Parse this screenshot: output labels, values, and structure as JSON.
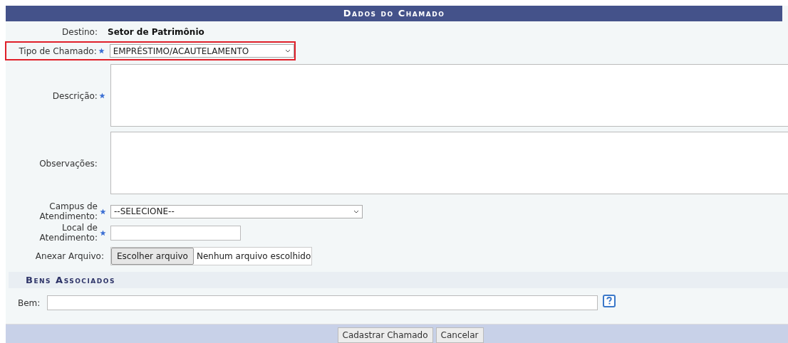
{
  "panel": {
    "title": "Dados do Chamado"
  },
  "destino": {
    "label": "Destino:",
    "value": "Setor de Patrimônio"
  },
  "fields": [
    {
      "kind": "select",
      "label": "Tipo de Chamado:",
      "required": true,
      "highlighted": true,
      "value": "EMPRÉSTIMO/ACAUTELAMENTO"
    },
    {
      "kind": "textarea",
      "label": "Descrição:",
      "required": true,
      "highlighted": false
    },
    {
      "kind": "textarea",
      "label": "Observações:",
      "required": false,
      "highlighted": false
    },
    {
      "kind": "select",
      "label": "Campus de Atendimento:",
      "required": true,
      "highlighted": false,
      "value": "--SELECIONE--"
    },
    {
      "kind": "text",
      "label": "Local de Atendimento:",
      "required": true,
      "highlighted": false
    },
    {
      "kind": "file",
      "label": "Anexar Arquivo:",
      "required": false,
      "highlighted": false,
      "button": "Escolher arquivo",
      "status": "Nenhum arquivo escolhido"
    }
  ],
  "section": {
    "title": "Bens Associados"
  },
  "bem": {
    "label": "Bem:"
  },
  "buttons": [
    "Cadastrar Chamado",
    "Cancelar"
  ]
}
